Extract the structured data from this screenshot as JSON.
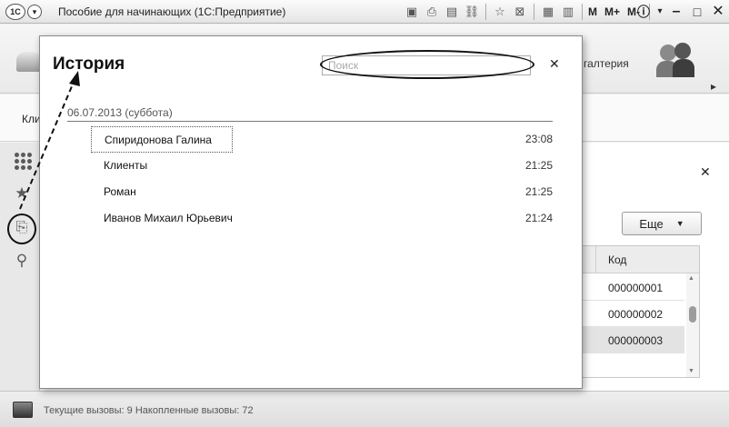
{
  "titlebar": {
    "logo": "1C",
    "title": "Пособие для начинающих  (1С:Предприятие)",
    "m": "M",
    "m_plus": "M+",
    "m_minus": "M-",
    "info": "i",
    "icons": [
      "floppy-icon",
      "printer-icon",
      "preview-icon",
      "link-icon",
      "star-outline-icon",
      "pin-icon",
      "calculator-icon",
      "calendar-icon"
    ]
  },
  "toppanel": {
    "section_label": "галтерия"
  },
  "crumbbar": {
    "text": "Кли"
  },
  "form": {
    "more_label": "Еще",
    "grid_header": "Код",
    "rows": [
      "000000001",
      "000000002",
      "000000003"
    ]
  },
  "statusbar": {
    "text": "Текущие вызовы: 9   Накопленные вызовы: 72"
  },
  "history": {
    "title": "История",
    "search_placeholder": "Поиск",
    "date": "06.07.2013 (суббота)",
    "items": [
      {
        "name": "Спиридонова Галина",
        "time": "23:08"
      },
      {
        "name": "Клиенты",
        "time": "21:25"
      },
      {
        "name": "Роман",
        "time": "21:25"
      },
      {
        "name": "Иванов Михаил Юрьевич",
        "time": "21:24"
      }
    ]
  },
  "colors": {
    "selection": "#e3e3e3",
    "annotation": "#111111"
  }
}
